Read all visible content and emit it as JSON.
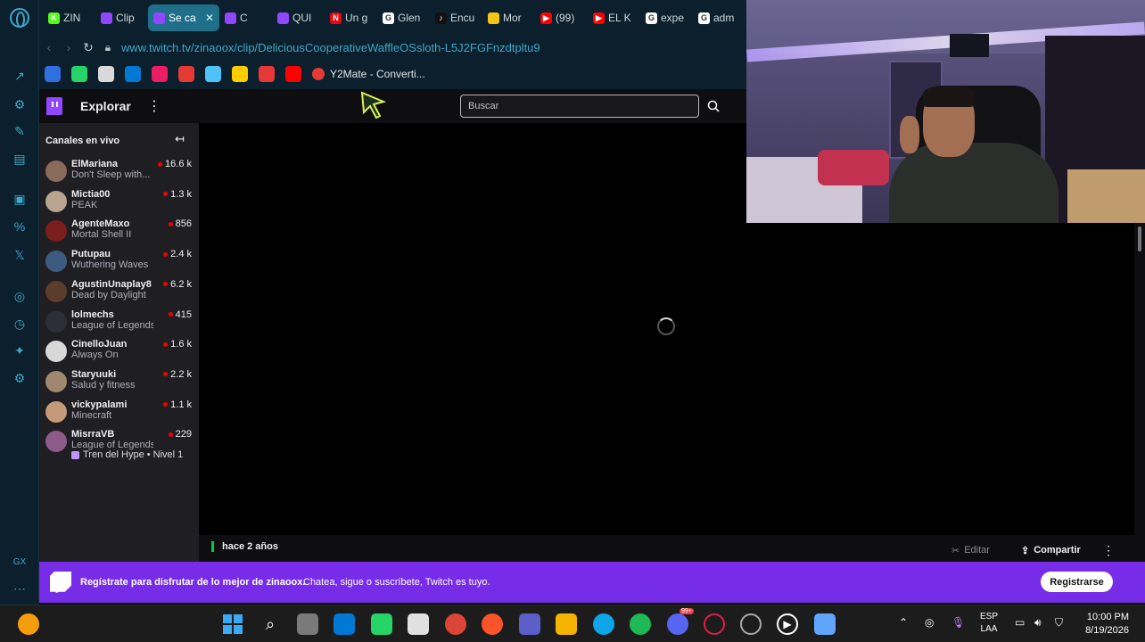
{
  "browser": {
    "tabs": [
      {
        "label": "ZIN",
        "fav_color": "#53fc18",
        "fav_text": "K"
      },
      {
        "label": "Clip",
        "fav_color": "#9146ff",
        "fav_text": ""
      },
      {
        "label": "Se ca",
        "fav_color": "#9146ff",
        "fav_text": "",
        "active": true
      },
      {
        "label": "C",
        "fav_color": "#9146ff",
        "fav_text": ""
      },
      {
        "label": "QUI",
        "fav_color": "#9146ff",
        "fav_text": ""
      },
      {
        "label": "Un g",
        "fav_color": "#e50914",
        "fav_text": "N"
      },
      {
        "label": "Glen",
        "fav_color": "#ffffff",
        "fav_text": "G"
      },
      {
        "label": "Encu",
        "fav_color": "#111111",
        "fav_text": "♪"
      },
      {
        "label": "Mor",
        "fav_color": "#f5c518",
        "fav_text": ""
      },
      {
        "label": "(99)",
        "fav_color": "#ff0000",
        "fav_text": "▶"
      },
      {
        "label": "EL K",
        "fav_color": "#ff0000",
        "fav_text": "▶"
      },
      {
        "label": "expe",
        "fav_color": "#ffffff",
        "fav_text": "G"
      },
      {
        "label": "adm",
        "fav_color": "#ffffff",
        "fav_text": "G"
      }
    ],
    "tab_close": "✕",
    "url": "www.twitch.tv/zinaoox/clip/DeliciousCooperativeWaffleOSsloth-L5J2FGFnzdtpltu9",
    "bookmark_label": "Y2Mate - Converti...",
    "bookmark_colors": [
      "#2f6fdf",
      "#25d366",
      "#d9d9d9",
      "#0078d4",
      "#e91e63",
      "#e53935",
      "#4fc3f7",
      "#ffcc00",
      "#e53935",
      "#ff0000"
    ]
  },
  "twitch": {
    "nav_explore": "Explorar",
    "nav_more": "⋮",
    "search_placeholder": "Buscar",
    "sidebar_title": "Canales en vivo",
    "collapse_icon": "↤",
    "channels": [
      {
        "name": "ElMariana",
        "game": "Don't Sleep with...",
        "viewers": "16.6 k",
        "color": "#8a6a5a"
      },
      {
        "name": "Mictia00",
        "game": "PEAK",
        "viewers": "1.3 k",
        "color": "#b8a48f"
      },
      {
        "name": "AgenteMaxo",
        "game": "Mortal Shell II",
        "viewers": "856",
        "color": "#7a1e1e"
      },
      {
        "name": "Putupau",
        "game": "Wuthering Waves",
        "viewers": "2.4 k",
        "color": "#3d5a80"
      },
      {
        "name": "AgustinUnaplay8",
        "game": "Dead by Daylight",
        "viewers": "6.2 k",
        "color": "#5a3d2b"
      },
      {
        "name": "lolmechs",
        "game": "League of Legends",
        "viewers": "415",
        "color": "#2e2e38"
      },
      {
        "name": "CinelloJuan",
        "game": "Always On",
        "viewers": "1.6 k",
        "color": "#d8d8d8"
      },
      {
        "name": "Staryuuki",
        "game": "Salud y fitness",
        "viewers": "2.2 k",
        "color": "#a08870"
      },
      {
        "name": "vickypalami",
        "game": "Minecraft",
        "viewers": "1.1 k",
        "color": "#c49a7a"
      },
      {
        "name": "MisrraVB",
        "game": "League of Legends",
        "viewers": "229",
        "color": "#8e5a8a"
      }
    ],
    "hype_train": "Tren del Hype • Nivel 1",
    "clip_age": "hace 2 años",
    "edit_label": "Editar",
    "share_label": "Compartir",
    "clip_more": "⋮",
    "banner_strong": "Regístrate para disfrutar de lo mejor de zinaoox.",
    "banner_text": "Chatea, sigue o suscríbete, Twitch es tuyo.",
    "register_label": "Registrarse",
    "accent": "#9146ff",
    "banner_color": "#772ce8"
  },
  "taskbar": {
    "lang_line1": "ESP",
    "lang_line2": "LAA",
    "time": "10:00 PM",
    "date": "8/19/2026",
    "discord_badge": "99+",
    "sidebar_text": "GX"
  }
}
